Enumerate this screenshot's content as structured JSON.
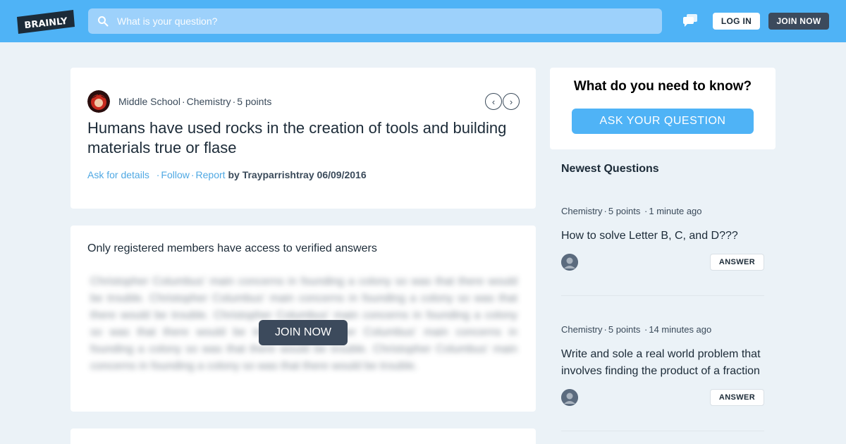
{
  "header": {
    "logo_text": "BRAINLY",
    "search_placeholder": "What is your question?",
    "login_label": "LOG IN",
    "join_label": "JOIN NOW"
  },
  "question": {
    "grade": "Middle School",
    "subject": "Chemistry",
    "points": "5 points",
    "title": "Humans have used rocks in the creation of tools and building materials true or flase",
    "ask_details": "Ask for details",
    "follow": "Follow",
    "report": "Report",
    "by": "by",
    "author": "Trayparrishtray",
    "date": "06/09/2016"
  },
  "answer_gate": {
    "heading": "Only registered members have access to verified answers",
    "blurred_text": "Christopher Columbus' main concerns in founding a colony so was that there would be trouble. Christopher Columbus' main concerns in founding a colony so was that there would be trouble. Christopher Columbus' main concerns in founding a colony so was that there would be trouble. Christopher Columbus' main concerns in founding a colony so was that there would be trouble. Christopher Columbus' main concerns in founding a colony so was that there would be trouble.",
    "join_label": "JOIN NOW"
  },
  "sidebar": {
    "ask_title": "What do you need to know?",
    "ask_button": "ASK YOUR QUESTION",
    "newest_title": "Newest Questions",
    "questions": [
      {
        "subject": "Chemistry",
        "points": "5 points",
        "time": "1 minute ago",
        "text": "How to solve Letter B, C, and D???",
        "answer_label": "ANSWER"
      },
      {
        "subject": "Chemistry",
        "points": "5 points",
        "time": "14 minutes ago",
        "text": "Write and sole a real world problem that involves finding the product of a fraction",
        "answer_label": "ANSWER"
      }
    ]
  },
  "colors": {
    "brand_blue": "#4fb3f6",
    "dark_button": "#3c4a5c",
    "link_blue": "#4fa8e3",
    "page_bg": "#ebf2f7"
  }
}
